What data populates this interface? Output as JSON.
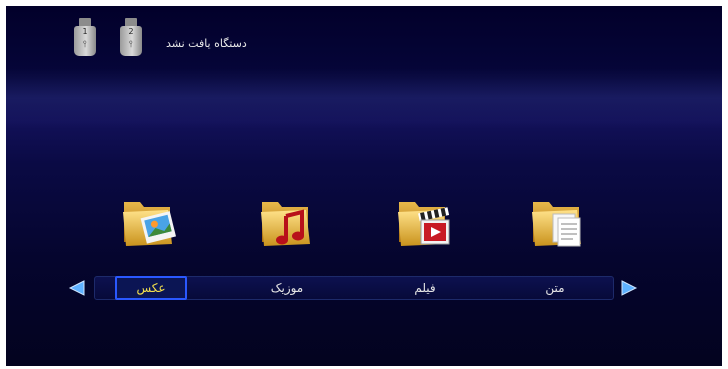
{
  "header": {
    "usb_devices": [
      {
        "number": "1",
        "icon": "usb-drive-icon"
      },
      {
        "number": "2",
        "icon": "usb-drive-icon"
      }
    ],
    "status_text": "دستگاه یافت نشد"
  },
  "categories": [
    {
      "label": "عکس",
      "icon": "photo-folder-icon",
      "selected": true
    },
    {
      "label": "موزیک",
      "icon": "music-folder-icon",
      "selected": false
    },
    {
      "label": "فیلم",
      "icon": "movie-folder-icon",
      "selected": false
    },
    {
      "label": "متن",
      "icon": "text-folder-icon",
      "selected": false
    }
  ],
  "navigation": {
    "left_icon": "triangle-left-icon",
    "right_icon": "triangle-right-icon"
  },
  "colors": {
    "background": "#03031f",
    "selected_text": "#f4e04c",
    "selected_border": "#2a58ff",
    "arrow": "#5fb2ff"
  }
}
